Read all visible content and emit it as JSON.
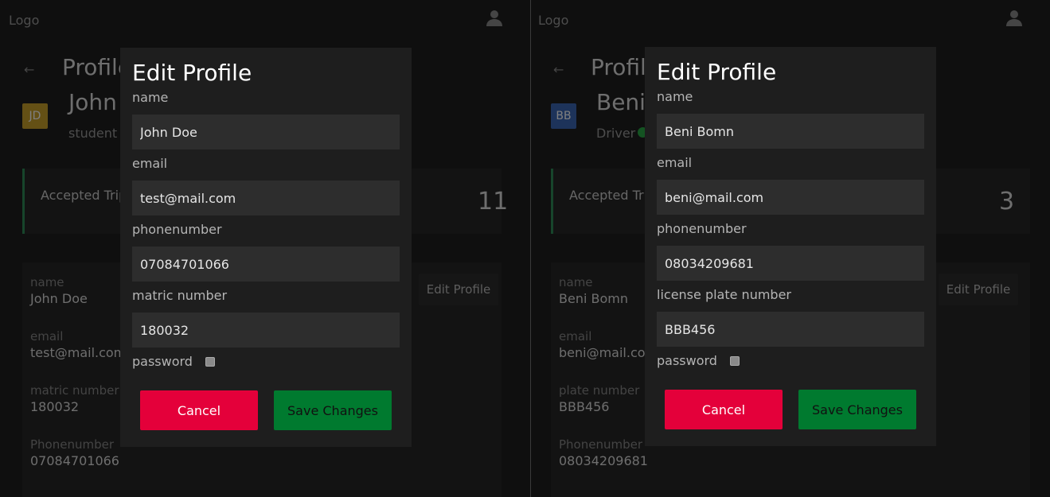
{
  "left": {
    "logo": "Logo",
    "page_title": "Profile",
    "avatar_initials": "JD",
    "avatar_color": "#c8a02a",
    "user_name": "John Doe",
    "user_role": "student",
    "card_label": "Accepted Trips",
    "card_count": "11",
    "edit_profile_label": "Edit Profile",
    "info": [
      {
        "label": "name",
        "value": "John Doe"
      },
      {
        "label": "email",
        "value": "test@mail.com"
      },
      {
        "label": "matric number",
        "value": "180032"
      },
      {
        "label": "Phonenumber",
        "value": "07084701066"
      }
    ],
    "modal": {
      "title": "Edit Profile",
      "fields": [
        {
          "label": "name",
          "value": "John Doe"
        },
        {
          "label": "email",
          "value": "test@mail.com"
        },
        {
          "label": "phonenumber",
          "value": "07084701066"
        },
        {
          "label": "matric number",
          "value": "180032"
        }
      ],
      "password_label": "password",
      "cancel_label": "Cancel",
      "save_label": "Save Changes"
    }
  },
  "right": {
    "logo": "Logo",
    "page_title": "Profile",
    "avatar_initials": "BB",
    "avatar_color": "#3a66b5",
    "user_name": "Beni Bomn",
    "user_role": "Driver",
    "card_label": "Accepted Trips",
    "card_count": "3",
    "edit_profile_label": "Edit Profile",
    "info": [
      {
        "label": "name",
        "value": "Beni Bomn"
      },
      {
        "label": "email",
        "value": "beni@mail.com"
      },
      {
        "label": "plate number",
        "value": "BBB456"
      },
      {
        "label": "Phonenumber",
        "value": "08034209681"
      }
    ],
    "modal": {
      "title": "Edit Profile",
      "fields": [
        {
          "label": "name",
          "value": "Beni Bomn"
        },
        {
          "label": "email",
          "value": "beni@mail.com"
        },
        {
          "label": "phonenumber",
          "value": "08034209681"
        },
        {
          "label": "license plate number",
          "value": "BBB456"
        }
      ],
      "password_label": "password",
      "cancel_label": "Cancel",
      "save_label": "Save Changes"
    }
  },
  "colors": {
    "cancel": "#e4003a",
    "save": "#007a2f",
    "status_online": "#28a745",
    "card_accent": "#2e8b57"
  }
}
